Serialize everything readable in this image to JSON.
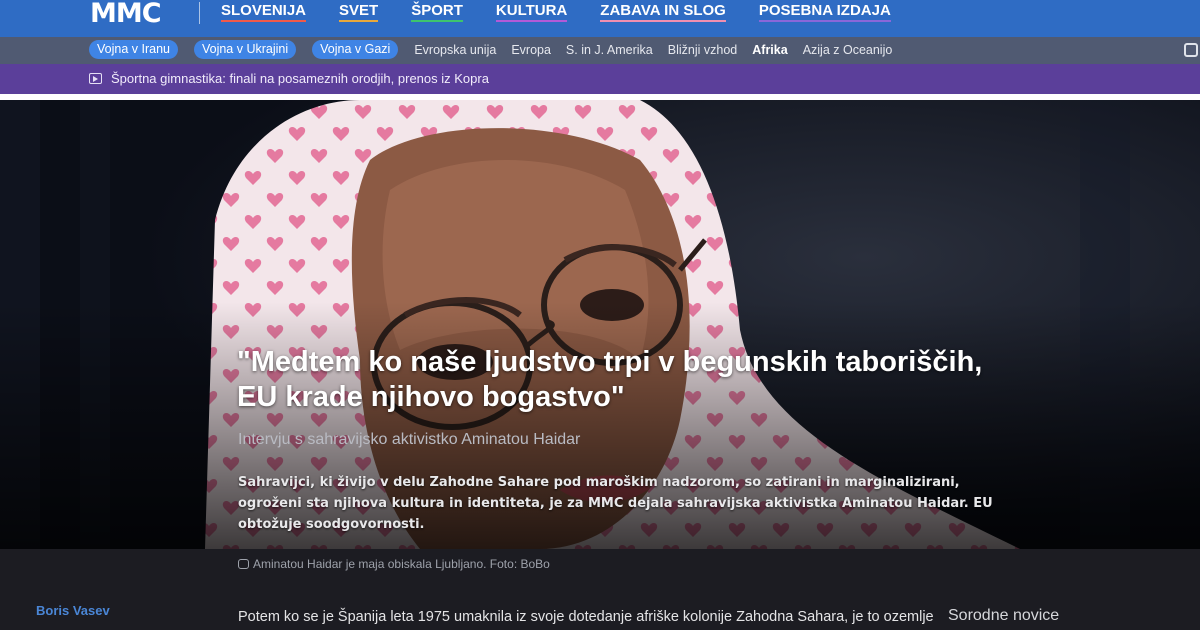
{
  "header": {
    "logo": "MMC",
    "nav": [
      {
        "label": "SLOVENIJA",
        "underline": "#f05a4a"
      },
      {
        "label": "SVET",
        "underline": "#e8a83c"
      },
      {
        "label": "ŠPORT",
        "underline": "#3ec46d"
      },
      {
        "label": "KULTURA",
        "underline": "#b25ad8"
      },
      {
        "label": "ZABAVA IN SLOG",
        "underline": "#f08fb0"
      },
      {
        "label": "POSEBNA IZDAJA",
        "underline": "#8a67d9"
      }
    ]
  },
  "subnav": {
    "pills": [
      "Vojna v Iranu",
      "Vojna v Ukrajini",
      "Vojna v Gazi"
    ],
    "links": [
      "Evropska unija",
      "Evropa",
      "S. in J. Amerika",
      "Bližnji vzhod",
      "Afrika",
      "Azija z Oceanijo"
    ],
    "active": "Afrika"
  },
  "live": {
    "text": "Športna gimnastika: finali na posameznih orodjih, prenos iz Kopra"
  },
  "article": {
    "headline_line1": "\"Medtem ko naše ljudstvo trpi v begunskih taboriščih,",
    "headline_line2": "EU krade njihovo bogastvo\"",
    "subtitle": "Intervju s sahravijsko aktivistko Aminatou Haidar",
    "lead": "Sahravijci, ki živijo v delu Zahodne Sahare pod maroškim nadzorom, so zatirani in marginalizirani, ogroženi sta njihova kultura in identiteta, je za MMC dejala sahravijska aktivistka Aminatou Haidar. EU obtožuje soodgovornosti.",
    "caption": "Aminatou Haidar je maja obiskala Ljubljano. Foto: BoBo",
    "author": "Boris Vasev",
    "body_start": "Potem ko se je Španija leta 1975 umaknila iz svoje dotedanje afriške kolonije Zahodna Sahara, je to ozemlje",
    "related_title": "Sorodne novice"
  },
  "colors": {
    "topbar": "#2f6cc4",
    "subbar": "#505a72",
    "livebar": "#5b3f9a",
    "pill": "#3f84e5",
    "author": "#4a86d6"
  }
}
